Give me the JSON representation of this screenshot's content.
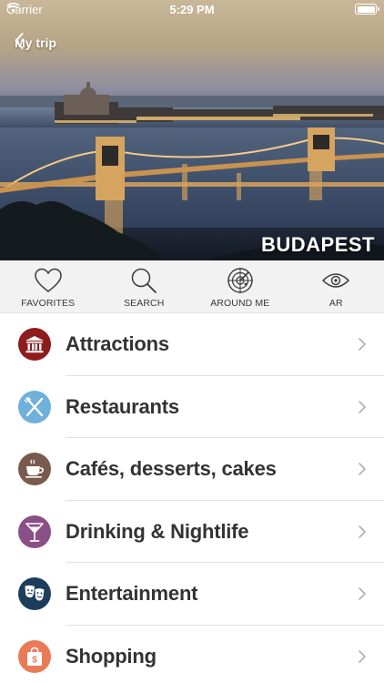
{
  "status_bar": {
    "carrier": "Carrier",
    "time": "5:29 PM"
  },
  "header": {
    "back_label": "My trip",
    "city": "BUDAPEST"
  },
  "toolbar": {
    "items": [
      {
        "label": "FAVORITES",
        "icon": "heart-icon"
      },
      {
        "label": "SEARCH",
        "icon": "search-icon"
      },
      {
        "label": "AROUND ME",
        "icon": "radar-icon"
      },
      {
        "label": "AR",
        "icon": "eye-icon"
      }
    ]
  },
  "categories": [
    {
      "label": "Attractions",
      "icon": "museum-icon",
      "color": "#8e1b1e"
    },
    {
      "label": "Restaurants",
      "icon": "fork-knife-icon",
      "color": "#6fb0dc"
    },
    {
      "label": "Cafés, desserts, cakes",
      "icon": "coffee-cup-icon",
      "color": "#7a5a4c"
    },
    {
      "label": "Drinking & Nightlife",
      "icon": "cocktail-icon",
      "color": "#8a4f86"
    },
    {
      "label": "Entertainment",
      "icon": "theater-masks-icon",
      "color": "#1e3d5c"
    },
    {
      "label": "Shopping",
      "icon": "shopping-bag-icon",
      "color": "#ea7a55"
    }
  ]
}
